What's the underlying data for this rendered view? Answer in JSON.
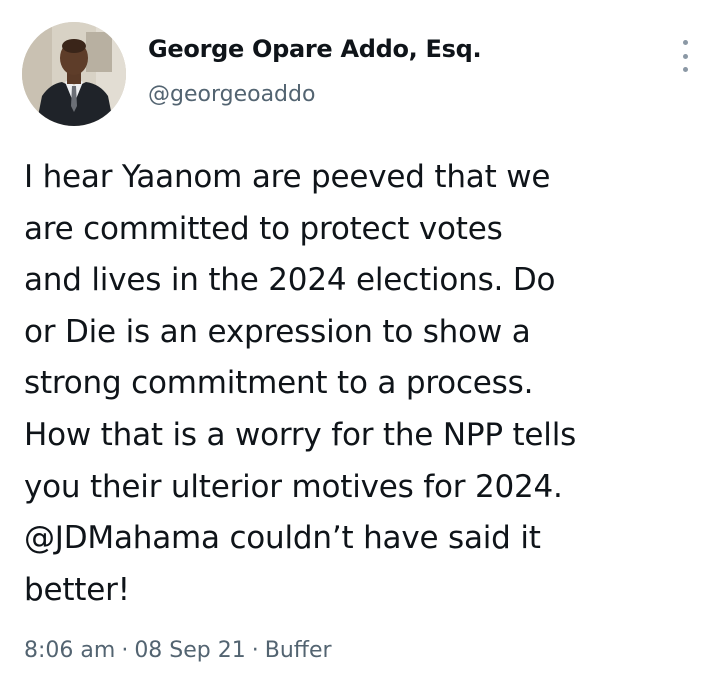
{
  "tweet": {
    "author": {
      "name": "George Opare Addo, Esq.",
      "handle": "@georgeoaddo",
      "avatar_icon": "profile-photo"
    },
    "more_icon": "more-options-icon",
    "text_lines": [
      "I hear Yaanom are peeved that we",
      "are committed to protect votes",
      "and lives in the 2024 elections. Do",
      "or Die is an expression to show a",
      "strong commitment to a process.",
      "How that is a worry for the NPP tells",
      "you their ulterior motives for 2024.",
      "@JDMahama couldn’t have said it",
      "better!"
    ],
    "meta": {
      "time": "8:06 am",
      "date": "08 Sep 21",
      "source": "Buffer",
      "separator": "·"
    }
  },
  "colors": {
    "text": "#0f1419",
    "secondary": "#536471",
    "icon": "#8b98a5",
    "background": "#ffffff"
  }
}
